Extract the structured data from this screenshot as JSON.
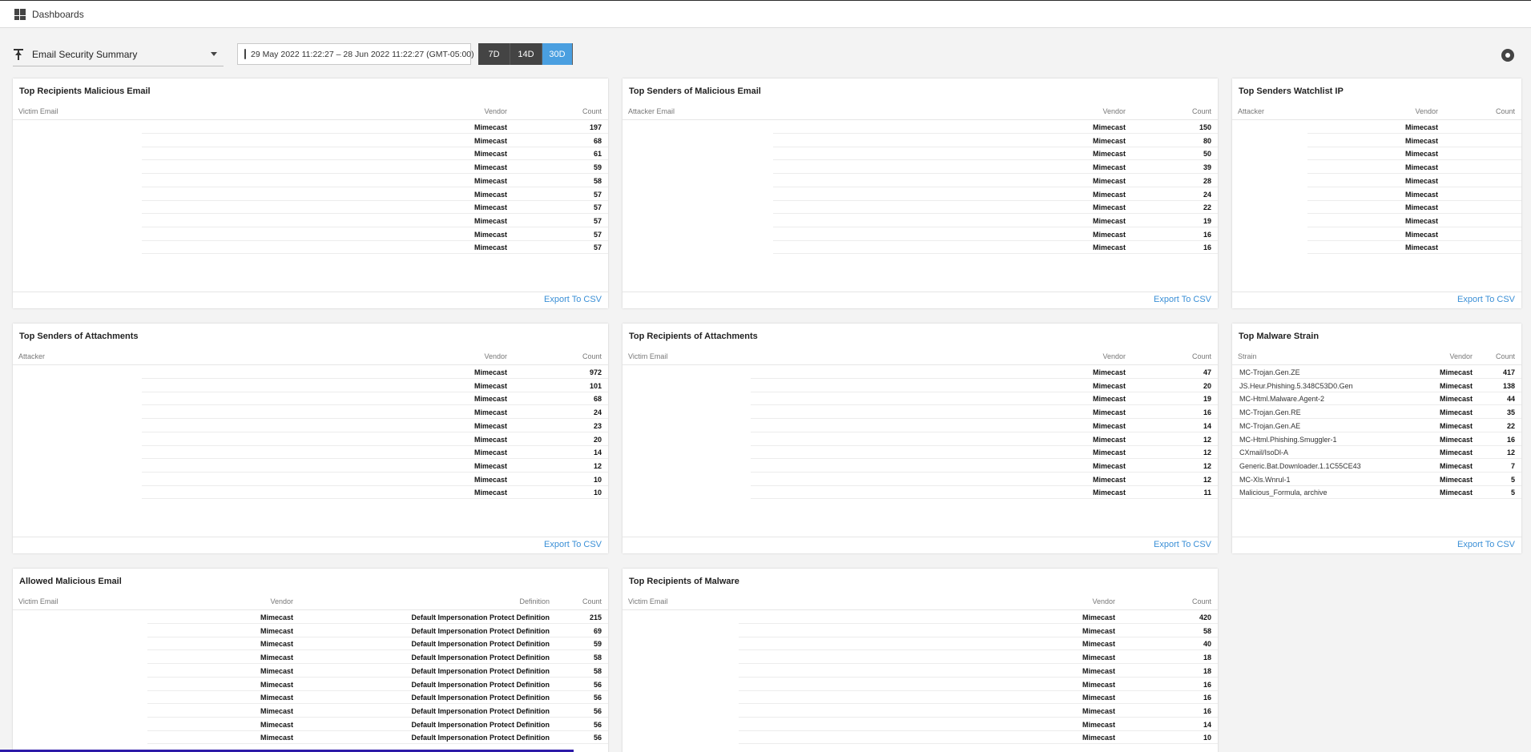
{
  "topbar": {
    "title": "Dashboards"
  },
  "toolbar": {
    "dashboard": "Email Security Summary",
    "date_range": "29 May 2022 11:22:27 – 28 Jun 2022 11:22:27 (GMT-05:00)",
    "ranges": [
      "7D",
      "14D",
      "30D"
    ],
    "active_range": "30D"
  },
  "export_label": "Export To CSV",
  "panels": [
    {
      "title": "Top Recipients Malicious Email",
      "columns": [
        "Victim Email",
        "Vendor",
        "Count"
      ],
      "rows": [
        [
          "",
          "Mimecast",
          "197"
        ],
        [
          "",
          "Mimecast",
          "68"
        ],
        [
          "",
          "Mimecast",
          "61"
        ],
        [
          "",
          "Mimecast",
          "59"
        ],
        [
          "",
          "Mimecast",
          "58"
        ],
        [
          "",
          "Mimecast",
          "57"
        ],
        [
          "",
          "Mimecast",
          "57"
        ],
        [
          "",
          "Mimecast",
          "57"
        ],
        [
          "",
          "Mimecast",
          "57"
        ],
        [
          "",
          "Mimecast",
          "57"
        ]
      ]
    },
    {
      "title": "Top Senders of Malicious Email",
      "columns": [
        "Attacker Email",
        "Vendor",
        "Count"
      ],
      "rows": [
        [
          "",
          "Mimecast",
          "150"
        ],
        [
          "",
          "Mimecast",
          "80"
        ],
        [
          "",
          "Mimecast",
          "50"
        ],
        [
          "",
          "Mimecast",
          "39"
        ],
        [
          "",
          "Mimecast",
          "28"
        ],
        [
          "",
          "Mimecast",
          "24"
        ],
        [
          "",
          "Mimecast",
          "22"
        ],
        [
          "",
          "Mimecast",
          "19"
        ],
        [
          "",
          "Mimecast",
          "16"
        ],
        [
          "",
          "Mimecast",
          "16"
        ]
      ]
    },
    {
      "title": "Top Senders Watchlist IP",
      "columns": [
        "Attacker",
        "Vendor",
        "Count"
      ],
      "rows": [
        [
          "",
          "Mimecast",
          ""
        ],
        [
          "",
          "Mimecast",
          ""
        ],
        [
          "",
          "Mimecast",
          ""
        ],
        [
          "",
          "Mimecast",
          ""
        ],
        [
          "",
          "Mimecast",
          ""
        ],
        [
          "",
          "Mimecast",
          ""
        ],
        [
          "",
          "Mimecast",
          ""
        ],
        [
          "",
          "Mimecast",
          ""
        ],
        [
          "",
          "Mimecast",
          ""
        ],
        [
          "",
          "Mimecast",
          ""
        ]
      ]
    },
    {
      "title": "Top Senders of Attachments",
      "columns": [
        "Attacker",
        "Vendor",
        "Count"
      ],
      "rows": [
        [
          "",
          "Mimecast",
          "972"
        ],
        [
          "",
          "Mimecast",
          "101"
        ],
        [
          "",
          "Mimecast",
          "68"
        ],
        [
          "",
          "Mimecast",
          "24"
        ],
        [
          "",
          "Mimecast",
          "23"
        ],
        [
          "",
          "Mimecast",
          "20"
        ],
        [
          "",
          "Mimecast",
          "14"
        ],
        [
          "",
          "Mimecast",
          "12"
        ],
        [
          "",
          "Mimecast",
          "10"
        ],
        [
          "",
          "Mimecast",
          "10"
        ]
      ]
    },
    {
      "title": "Top Recipients of Attachments",
      "columns": [
        "Victim Email",
        "Vendor",
        "Count"
      ],
      "rows": [
        [
          "",
          "Mimecast",
          "47"
        ],
        [
          "",
          "Mimecast",
          "20"
        ],
        [
          "",
          "Mimecast",
          "19"
        ],
        [
          "",
          "Mimecast",
          "16"
        ],
        [
          "",
          "Mimecast",
          "14"
        ],
        [
          "",
          "Mimecast",
          "12"
        ],
        [
          "",
          "Mimecast",
          "12"
        ],
        [
          "",
          "Mimecast",
          "12"
        ],
        [
          "",
          "Mimecast",
          "12"
        ],
        [
          "",
          "Mimecast",
          "11"
        ]
      ]
    },
    {
      "title": "Top Malware Strain",
      "columns": [
        "Strain",
        "Vendor",
        "Count"
      ],
      "rows": [
        [
          "MC-Trojan.Gen.ZE",
          "Mimecast",
          "417"
        ],
        [
          "JS.Heur.Phishing.5.348C53D0.Gen",
          "Mimecast",
          "138"
        ],
        [
          "MC-Html.Malware.Agent-2",
          "Mimecast",
          "44"
        ],
        [
          "MC-Trojan.Gen.RE",
          "Mimecast",
          "35"
        ],
        [
          "MC-Trojan.Gen.AE",
          "Mimecast",
          "22"
        ],
        [
          "MC-Html.Phishing.Smuggler-1",
          "Mimecast",
          "16"
        ],
        [
          "CXmail/IsoDl-A",
          "Mimecast",
          "12"
        ],
        [
          "Generic.Bat.Downloader.1.1C55CE43",
          "Mimecast",
          "7"
        ],
        [
          "MC-Xls.Wnrul-1",
          "Mimecast",
          "5"
        ],
        [
          "Malicious_Formula, archive",
          "Mimecast",
          "5"
        ]
      ]
    },
    {
      "title": "Allowed Malicious Email",
      "columns": [
        "Victim Email",
        "Vendor",
        "Definition",
        "Count"
      ],
      "rows": [
        [
          "",
          "Mimecast",
          "Default Impersonation Protect Definition",
          "215"
        ],
        [
          "",
          "Mimecast",
          "Default Impersonation Protect Definition",
          "69"
        ],
        [
          "",
          "Mimecast",
          "Default Impersonation Protect Definition",
          "59"
        ],
        [
          "",
          "Mimecast",
          "Default Impersonation Protect Definition",
          "58"
        ],
        [
          "",
          "Mimecast",
          "Default Impersonation Protect Definition",
          "58"
        ],
        [
          "",
          "Mimecast",
          "Default Impersonation Protect Definition",
          "56"
        ],
        [
          "",
          "Mimecast",
          "Default Impersonation Protect Definition",
          "56"
        ],
        [
          "",
          "Mimecast",
          "Default Impersonation Protect Definition",
          "56"
        ],
        [
          "",
          "Mimecast",
          "Default Impersonation Protect Definition",
          "56"
        ],
        [
          "",
          "Mimecast",
          "Default Impersonation Protect Definition",
          "56"
        ]
      ]
    },
    {
      "title": "Top Recipients of Malware",
      "columns": [
        "Victim Email",
        "Vendor",
        "Count"
      ],
      "rows": [
        [
          "",
          "Mimecast",
          "420"
        ],
        [
          "",
          "Mimecast",
          "58"
        ],
        [
          "",
          "Mimecast",
          "40"
        ],
        [
          "",
          "Mimecast",
          "18"
        ],
        [
          "",
          "Mimecast",
          "18"
        ],
        [
          "",
          "Mimecast",
          "16"
        ],
        [
          "",
          "Mimecast",
          "16"
        ],
        [
          "",
          "Mimecast",
          "16"
        ],
        [
          "",
          "Mimecast",
          "14"
        ],
        [
          "",
          "Mimecast",
          "10"
        ]
      ]
    }
  ]
}
